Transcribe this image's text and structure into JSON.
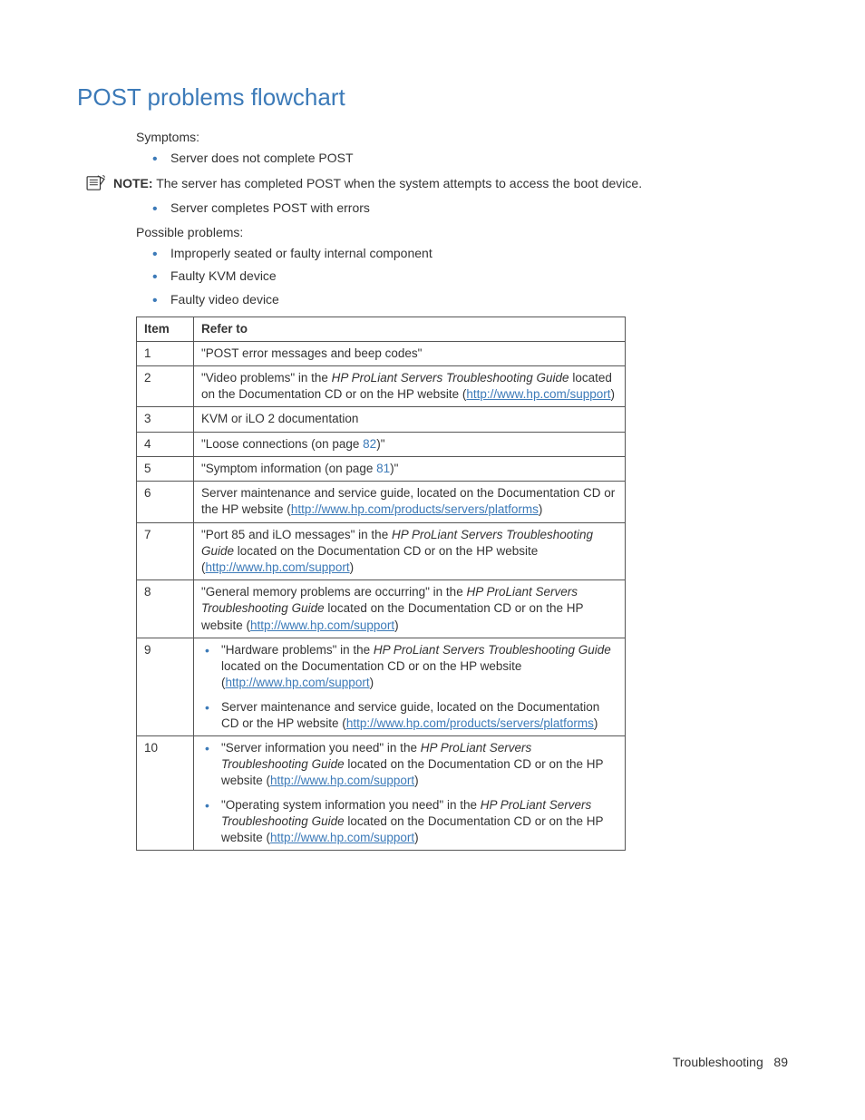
{
  "heading": "POST problems flowchart",
  "symptoms_label": "Symptoms:",
  "symptoms": [
    "Server does not complete POST"
  ],
  "note_label": "NOTE:",
  "note_text": "The server has completed POST when the system attempts to access the boot device.",
  "symptoms2": [
    "Server completes POST with errors"
  ],
  "possible_label": "Possible problems:",
  "possible": [
    "Improperly seated or faulty internal component",
    "Faulty KVM device",
    "Faulty video device"
  ],
  "table": {
    "headers": [
      "Item",
      "Refer to"
    ],
    "rows": [
      {
        "item": "1",
        "parts": [
          {
            "t": "text",
            "v": "\"POST error messages and beep codes\""
          }
        ]
      },
      {
        "item": "2",
        "parts": [
          {
            "t": "text",
            "v": "\"Video problems\" in the "
          },
          {
            "t": "italic",
            "v": "HP ProLiant Servers Troubleshooting Guide"
          },
          {
            "t": "text",
            "v": " located on the Documentation CD or on the HP website ("
          },
          {
            "t": "link",
            "v": "http://www.hp.com/support"
          },
          {
            "t": "text",
            "v": ")"
          }
        ]
      },
      {
        "item": "3",
        "parts": [
          {
            "t": "text",
            "v": "KVM or iLO 2 documentation"
          }
        ]
      },
      {
        "item": "4",
        "parts": [
          {
            "t": "text",
            "v": "\"Loose connections (on page "
          },
          {
            "t": "pageref",
            "v": "82"
          },
          {
            "t": "text",
            "v": ")\""
          }
        ]
      },
      {
        "item": "5",
        "parts": [
          {
            "t": "text",
            "v": "\"Symptom information (on page "
          },
          {
            "t": "pageref",
            "v": "81"
          },
          {
            "t": "text",
            "v": ")\""
          }
        ]
      },
      {
        "item": "6",
        "parts": [
          {
            "t": "text",
            "v": "Server maintenance and service guide, located on the Documentation CD or the HP website ("
          },
          {
            "t": "link",
            "v": "http://www.hp.com/products/servers/platforms"
          },
          {
            "t": "text",
            "v": ")"
          }
        ]
      },
      {
        "item": "7",
        "parts": [
          {
            "t": "text",
            "v": "\"Port 85 and iLO messages\" in the "
          },
          {
            "t": "italic",
            "v": "HP ProLiant Servers Troubleshooting Guide"
          },
          {
            "t": "text",
            "v": " located on the Documentation CD or on the HP website ("
          },
          {
            "t": "link",
            "v": "http://www.hp.com/support"
          },
          {
            "t": "text",
            "v": ")"
          }
        ]
      },
      {
        "item": "8",
        "parts": [
          {
            "t": "text",
            "v": "\"General memory problems are occurring\" in the "
          },
          {
            "t": "italic",
            "v": "HP ProLiant Servers Troubleshooting Guide"
          },
          {
            "t": "text",
            "v": " located on the Documentation CD or on the HP website ("
          },
          {
            "t": "link",
            "v": "http://www.hp.com/support"
          },
          {
            "t": "text",
            "v": ")"
          }
        ]
      },
      {
        "item": "9",
        "bullets": [
          [
            {
              "t": "text",
              "v": "\"Hardware problems\" in the "
            },
            {
              "t": "italic",
              "v": "HP ProLiant Servers Troubleshooting Guide"
            },
            {
              "t": "text",
              "v": " located on the Documentation CD or on the HP website ("
            },
            {
              "t": "link",
              "v": "http://www.hp.com/support"
            },
            {
              "t": "text",
              "v": ")"
            }
          ],
          [
            {
              "t": "text",
              "v": "Server maintenance and service guide, located on the Documentation CD or the HP website ("
            },
            {
              "t": "link",
              "v": "http://www.hp.com/products/servers/platforms"
            },
            {
              "t": "text",
              "v": ")"
            }
          ]
        ]
      },
      {
        "item": "10",
        "bullets": [
          [
            {
              "t": "text",
              "v": "\"Server information you need\" in the "
            },
            {
              "t": "italic",
              "v": "HP ProLiant Servers Troubleshooting Guide"
            },
            {
              "t": "text",
              "v": " located on the Documentation CD or on the HP website ("
            },
            {
              "t": "link",
              "v": "http://www.hp.com/support"
            },
            {
              "t": "text",
              "v": ")"
            }
          ],
          [
            {
              "t": "text",
              "v": "\"Operating system information you need\" in the "
            },
            {
              "t": "italic",
              "v": "HP ProLiant Servers Troubleshooting Guide"
            },
            {
              "t": "text",
              "v": " located on the Documentation CD or on the HP website ("
            },
            {
              "t": "link",
              "v": "http://www.hp.com/support"
            },
            {
              "t": "text",
              "v": ")"
            }
          ]
        ]
      }
    ]
  },
  "footer_section": "Troubleshooting",
  "footer_page": "89"
}
